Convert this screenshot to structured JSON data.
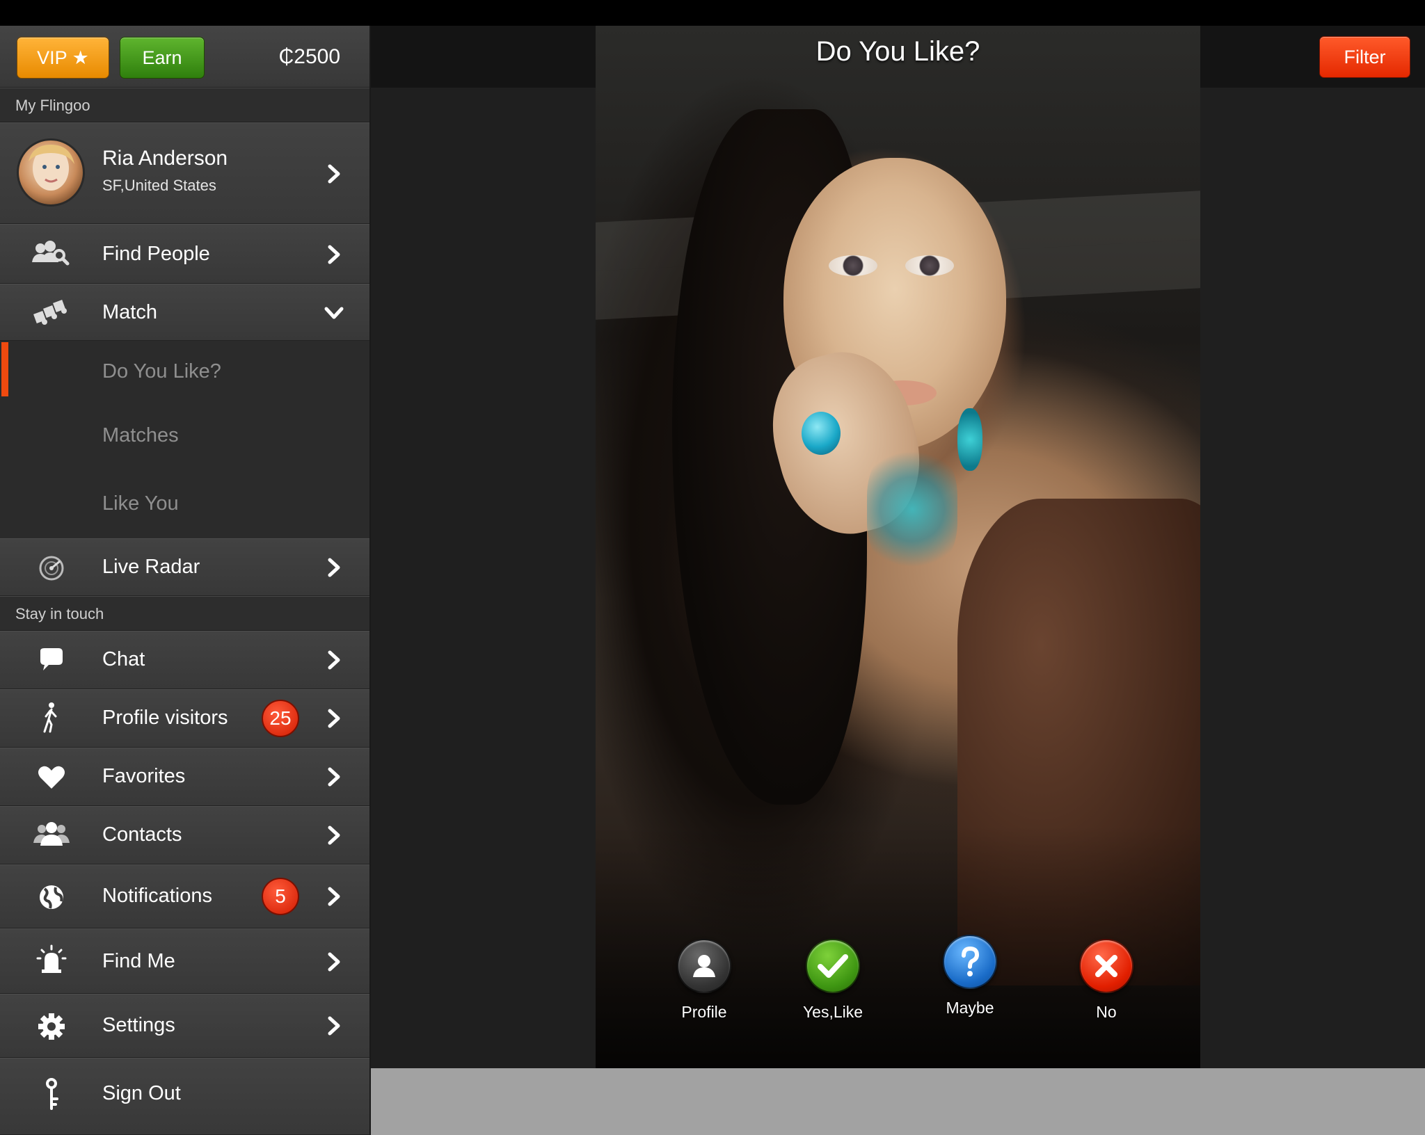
{
  "header": {
    "vip_label": "VIP ★",
    "earn_label": "Earn",
    "coins": "₵2500",
    "title": "Do You Like?",
    "filter_label": "Filter"
  },
  "sidebar": {
    "section_my": "My Flingoo",
    "profile": {
      "name": "Ria Anderson",
      "location": "SF,United States"
    },
    "items": [
      {
        "label": "Find People",
        "icon": "find-people-icon"
      },
      {
        "label": "Match",
        "icon": "puzzle-icon"
      }
    ],
    "match_sub": [
      "Do You Like?",
      "Matches",
      "Like You"
    ],
    "live_radar": "Live Radar",
    "section_stay": "Stay in touch",
    "stay_items": [
      {
        "label": "Chat",
        "icon": "chat-bubble-icon"
      },
      {
        "label": "Profile visitors",
        "icon": "walking-person-icon",
        "badge": "25"
      },
      {
        "label": "Favorites",
        "icon": "heart-icon"
      },
      {
        "label": "Contacts",
        "icon": "contacts-icon"
      },
      {
        "label": "Notifications",
        "icon": "globe-icon",
        "badge": "5"
      },
      {
        "label": "Find Me",
        "icon": "siren-icon"
      },
      {
        "label": "Settings",
        "icon": "gear-icon"
      },
      {
        "label": "Sign Out",
        "icon": "key-icon"
      }
    ]
  },
  "actions": {
    "profile": "Profile",
    "yes": "Yes,Like",
    "maybe": "Maybe",
    "no": "No"
  },
  "colors": {
    "vip": "#f29b1a",
    "earn": "#3f8f15",
    "filter": "#f23a0a",
    "badge": "#e42a0a",
    "active_indicator": "#f04a0f"
  }
}
